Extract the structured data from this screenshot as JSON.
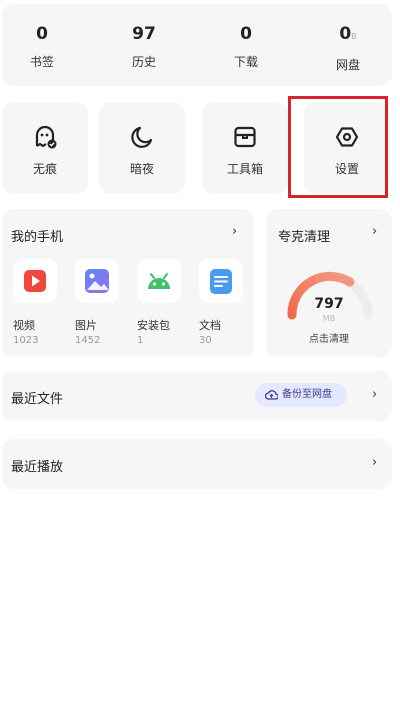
{
  "stats": [
    {
      "value": "0",
      "label": "书签"
    },
    {
      "value": "97",
      "label": "历史"
    },
    {
      "value": "0",
      "label": "下载"
    },
    {
      "value": "0",
      "unit": "B",
      "label": "网盘"
    }
  ],
  "tools": [
    {
      "label": "无痕",
      "icon": "incognito-ghost-icon"
    },
    {
      "label": "暗夜",
      "icon": "moon-icon"
    },
    {
      "label": "工具箱",
      "icon": "toolbox-icon"
    },
    {
      "label": "设置",
      "icon": "settings-hexagon-icon"
    }
  ],
  "my_phone": {
    "title": "我的手机",
    "items": [
      {
        "label": "视频",
        "count": "1023",
        "icon": "video-play-icon",
        "color": "#f0463c"
      },
      {
        "label": "图片",
        "count": "1452",
        "icon": "image-icon",
        "color": "#6a7ff0"
      },
      {
        "label": "安装包",
        "count": "1",
        "icon": "android-icon",
        "color": "#3fc06b"
      },
      {
        "label": "文档",
        "count": "30",
        "icon": "document-icon",
        "color": "#4a9af0"
      }
    ]
  },
  "clean": {
    "title": "夸克清理",
    "value": "797",
    "unit": "MB",
    "action": "点击清理",
    "colors": {
      "gauge_start": "#f06a4a",
      "gauge_track": "#ececec"
    }
  },
  "recent_files": {
    "title": "最近文件",
    "backup_label": "备份至网盘",
    "accent": "#e6e8ff"
  },
  "recent_play": {
    "title": "最近播放"
  }
}
